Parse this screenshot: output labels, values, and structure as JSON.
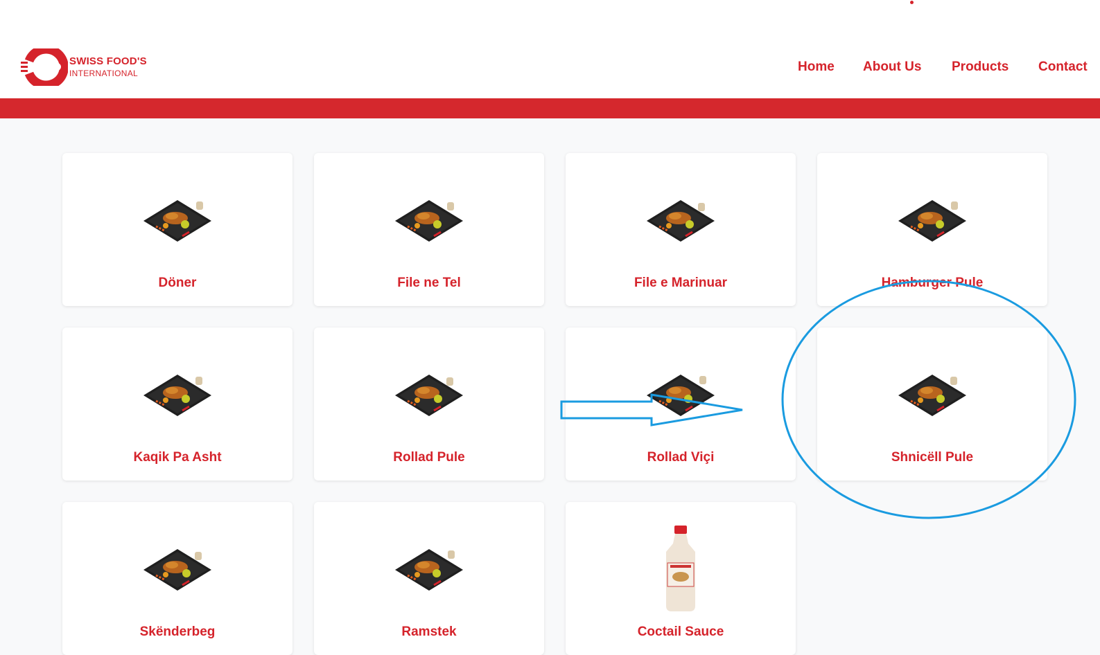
{
  "brand": {
    "name": "SWISS FOOD'S",
    "subtitle": "INTERNATIONAL",
    "color": "#d5232b"
  },
  "nav": {
    "items": [
      "Home",
      "About Us",
      "Products",
      "Contact"
    ]
  },
  "products": [
    {
      "name": "Döner",
      "icon": "food-plate-icon"
    },
    {
      "name": "File ne Tel",
      "icon": "food-plate-icon"
    },
    {
      "name": "File e Marinuar",
      "icon": "food-plate-icon"
    },
    {
      "name": "Hamburger Pule",
      "icon": "food-plate-icon"
    },
    {
      "name": "Kaqik Pa Asht",
      "icon": "food-plate-icon"
    },
    {
      "name": "Rollad Pule",
      "icon": "food-plate-icon"
    },
    {
      "name": "Rollad Viçi",
      "icon": "food-plate-icon"
    },
    {
      "name": "Shnicëll Pule",
      "icon": "food-plate-icon"
    },
    {
      "name": "Skënderbeg",
      "icon": "food-plate-icon"
    },
    {
      "name": "Ramstek",
      "icon": "food-plate-icon"
    },
    {
      "name": "Coctail Sauce",
      "icon": "sauce-bottle-icon"
    }
  ],
  "annotation": {
    "color": "#1a9be0",
    "highlighted_product": "Shnicëll Pule"
  }
}
